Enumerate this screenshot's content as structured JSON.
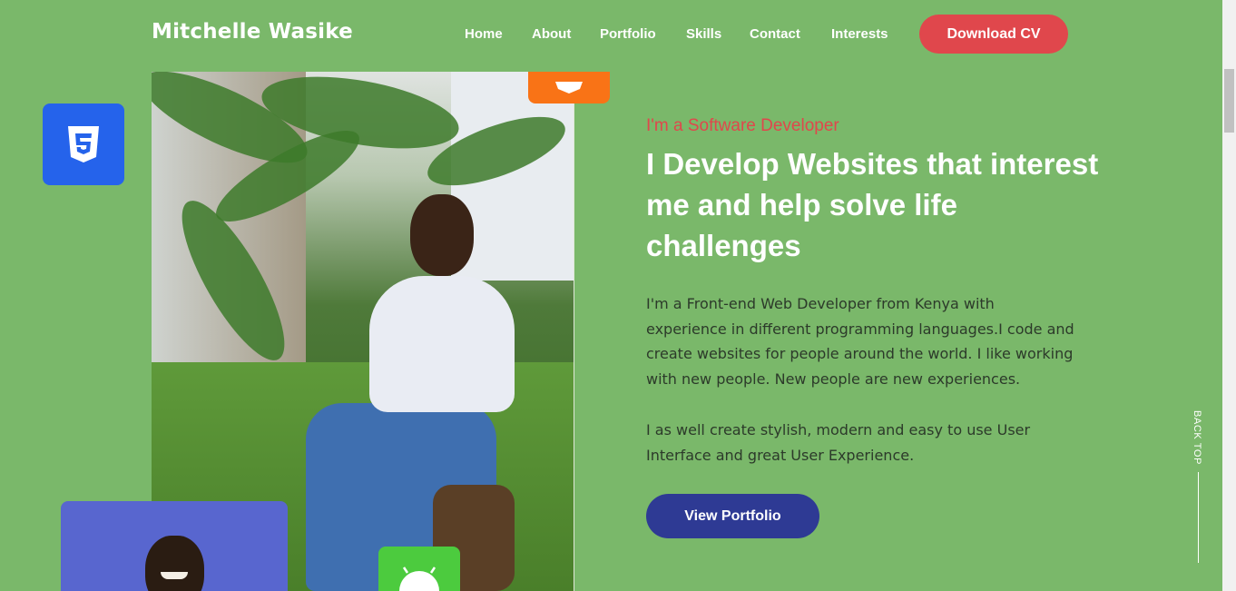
{
  "brand": "Mitchelle Wasike",
  "nav": {
    "items": [
      "Home",
      "About",
      "Portfolio",
      "Skills",
      "Contact",
      "Interests"
    ],
    "cta": "Download CV"
  },
  "hero": {
    "eyebrow": "I'm a Software Developer",
    "headline": "I Develop Websites that interest me and help solve life challenges",
    "paragraph1": "I'm a Front-end Web Developer from Kenya with experience in different programming languages.I code and create websites for people around the world. I like working with new people. New people are new experiences.",
    "paragraph2": "I as well create stylish, modern and easy to use User Interface and great User Experience.",
    "button": "View Portfolio"
  },
  "back_top": "BACK TOP",
  "colors": {
    "background": "#7ab86a",
    "accent_red": "#e0474c",
    "button_blue": "#2e3a94",
    "css_tile": "#2563eb",
    "html_tile": "#f97316",
    "android_tile": "#4ccb3e"
  },
  "icons": [
    "css3-icon",
    "html5-icon",
    "android-icon"
  ]
}
